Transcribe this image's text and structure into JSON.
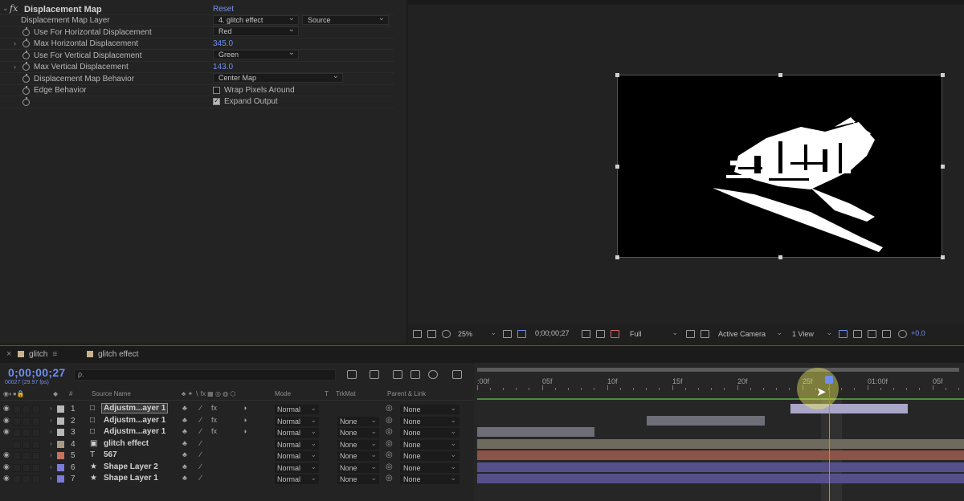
{
  "effect_controls": {
    "effect_badge": "fx",
    "effect_name": "Displacement Map",
    "reset_label": "Reset",
    "properties": [
      {
        "label": "Displacement Map Layer",
        "value": "4. glitch effect",
        "value2": "Source"
      },
      {
        "label": "Use For Horizontal Displacement",
        "value": "Red"
      },
      {
        "label": "Max Horizontal Displacement",
        "value": "345.0"
      },
      {
        "label": "Use For Vertical Displacement",
        "value": "Green"
      },
      {
        "label": "Max Vertical Displacement",
        "value": "143.0"
      },
      {
        "label": "Displacement Map Behavior",
        "value": "Center Map"
      },
      {
        "label": "Edge Behavior",
        "value": "Wrap Pixels Around",
        "checked": false
      },
      {
        "label": "",
        "value": "Expand Output",
        "checked": true
      }
    ]
  },
  "viewer_toolbar": {
    "zoom": "25%",
    "timecode": "0;00;00;27",
    "resolution": "Full",
    "camera": "Active Camera",
    "views": "1 View",
    "exposure": "+0.0"
  },
  "timeline": {
    "tabs": [
      {
        "label": "glitch",
        "swatch": "#c9b28c"
      },
      {
        "label": "glitch effect",
        "swatch": "#c9b28c"
      }
    ],
    "timecode": "0;00;00;27",
    "timecode_sub": "00027 (29.97 fps)",
    "search_icon": "ρ.",
    "columns": {
      "source_name": "Source Name",
      "mode": "Mode",
      "t": "T",
      "trkmat": "TrkMat",
      "parent": "Parent & Link",
      "hash": "#"
    },
    "ruler": [
      ":00f",
      "05f",
      "10f",
      "15f",
      "20f",
      "25f",
      "01:00f",
      "05f"
    ],
    "layers": [
      {
        "num": "1",
        "name": "Adjustm...ayer 1",
        "type": "□",
        "label_color": "#b8b8b8",
        "mode": "Normal",
        "trkmat": "",
        "parent": "None",
        "boxed": true
      },
      {
        "num": "2",
        "name": "Adjustm...ayer 1",
        "type": "□",
        "label_color": "#b8b8b8",
        "mode": "Normal",
        "trkmat": "None",
        "parent": "None",
        "boxed": false
      },
      {
        "num": "3",
        "name": "Adjustm...ayer 1",
        "type": "□",
        "label_color": "#b8b8b8",
        "mode": "Normal",
        "trkmat": "None",
        "parent": "None",
        "boxed": false
      },
      {
        "num": "4",
        "name": "glitch effect",
        "type": "▣",
        "label_color": "#a89a80",
        "mode": "Normal",
        "trkmat": "None",
        "parent": "None",
        "boxed": false
      },
      {
        "num": "5",
        "name": "567",
        "type": "T",
        "label_color": "#c4735c",
        "mode": "Normal",
        "trkmat": "None",
        "parent": "None",
        "boxed": false
      },
      {
        "num": "6",
        "name": "Shape Layer 2",
        "type": "★",
        "label_color": "#7a7adc",
        "mode": "Normal",
        "trkmat": "None",
        "parent": "None",
        "boxed": false
      },
      {
        "num": "7",
        "name": "Shape Layer 1",
        "type": "★",
        "label_color": "#7a7adc",
        "mode": "Normal",
        "trkmat": "None",
        "parent": "None",
        "boxed": false
      }
    ],
    "bar_colors": [
      "#a9a6c8",
      "#6e6e78",
      "#6e6e78",
      "#6f6a5e",
      "#8a5448",
      "#55508a",
      "#55508a"
    ]
  }
}
